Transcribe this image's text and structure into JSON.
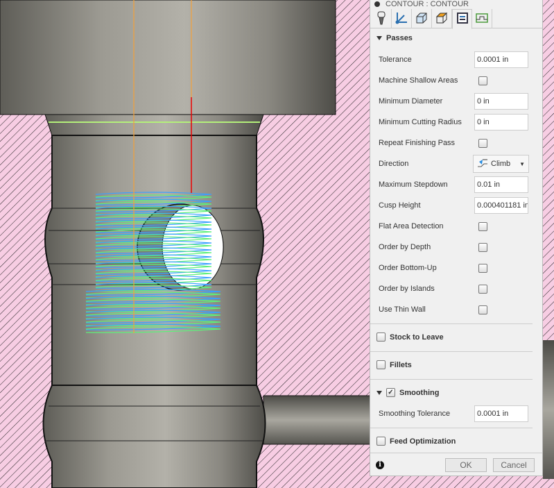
{
  "panel": {
    "title": "CONTOUR : CONTOUR",
    "tabs": [
      "tool-icon",
      "geometry-icon",
      "heights-icon",
      "stock-icon",
      "passes-icon",
      "linking-icon"
    ],
    "passes": {
      "header": "Passes",
      "tolerance": {
        "label": "Tolerance",
        "value": "0.0001 in"
      },
      "machine_shallow": {
        "label": "Machine Shallow Areas",
        "checked": false
      },
      "min_diameter": {
        "label": "Minimum Diameter",
        "value": "0 in"
      },
      "min_cutting_radius": {
        "label": "Minimum Cutting Radius",
        "value": "0 in"
      },
      "repeat_finishing": {
        "label": "Repeat Finishing Pass",
        "checked": false
      },
      "direction": {
        "label": "Direction",
        "value": "Climb"
      },
      "max_stepdown": {
        "label": "Maximum Stepdown",
        "value": "0.01 in"
      },
      "cusp_height": {
        "label": "Cusp Height",
        "value": "0.000401181 in"
      },
      "flat_area": {
        "label": "Flat Area Detection",
        "checked": false
      },
      "order_depth": {
        "label": "Order by Depth",
        "checked": false
      },
      "order_bottom_up": {
        "label": "Order Bottom-Up",
        "checked": false
      },
      "order_islands": {
        "label": "Order by Islands",
        "checked": false
      },
      "thin_wall": {
        "label": "Use Thin Wall",
        "checked": false
      }
    },
    "stock_to_leave": {
      "label": "Stock to Leave",
      "checked": false
    },
    "fillets": {
      "label": "Fillets",
      "checked": false
    },
    "smoothing": {
      "label": "Smoothing",
      "checked": true,
      "check": "✓",
      "tol_label": "Smoothing Tolerance",
      "tol_value": "0.0001 in"
    },
    "feed_opt": {
      "label": "Feed Optimization",
      "checked": false
    },
    "ok": "OK",
    "cancel": "Cancel",
    "info": "i"
  }
}
